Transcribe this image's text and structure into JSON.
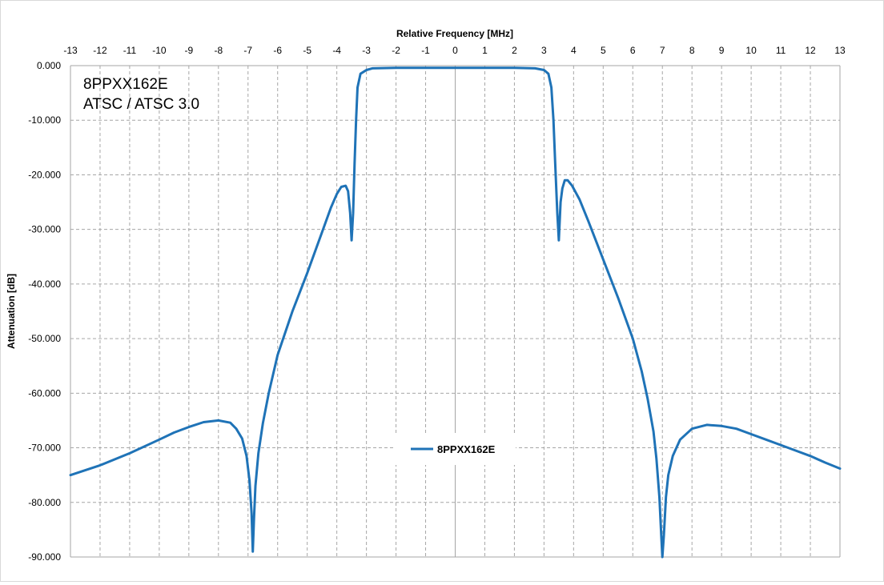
{
  "chart_data": {
    "type": "line",
    "title": "",
    "xlabel": "Relative Frequency [MHz]",
    "ylabel": "Attenuation [dB]",
    "xlim": [
      -13,
      13
    ],
    "ylim": [
      -90,
      0
    ],
    "xticks": [
      "-13",
      "-12",
      "-11",
      "-10",
      "-9",
      "-8",
      "-7",
      "-6",
      "-5",
      "-4",
      "-3",
      "-2",
      "-1",
      "0",
      "1",
      "2",
      "3",
      "4",
      "5",
      "6",
      "7",
      "8",
      "9",
      "10",
      "11",
      "12",
      "13"
    ],
    "yticks": [
      "0.000",
      "-10.000",
      "-20.000",
      "-30.000",
      "-40.000",
      "-50.000",
      "-60.000",
      "-70.000",
      "-80.000",
      "-90.000"
    ],
    "x_axis_position": "top",
    "grid": "dashed",
    "legend_position": "center",
    "annotations": [
      "8PPXX162E",
      "ATSC / ATSC 3.0"
    ],
    "series": [
      {
        "name": "8PPXX162E",
        "color": "#1f73b7",
        "points": [
          [
            -13.0,
            -75.0
          ],
          [
            -12.0,
            -73.2
          ],
          [
            -11.0,
            -71.0
          ],
          [
            -10.0,
            -68.5
          ],
          [
            -9.5,
            -67.2
          ],
          [
            -9.0,
            -66.2
          ],
          [
            -8.5,
            -65.3
          ],
          [
            -8.0,
            -65.0
          ],
          [
            -7.6,
            -65.4
          ],
          [
            -7.4,
            -66.5
          ],
          [
            -7.2,
            -68.3
          ],
          [
            -7.05,
            -71.5
          ],
          [
            -6.95,
            -76.0
          ],
          [
            -6.88,
            -82.0
          ],
          [
            -6.84,
            -89.0
          ],
          [
            -6.8,
            -83.0
          ],
          [
            -6.75,
            -77.0
          ],
          [
            -6.65,
            -71.0
          ],
          [
            -6.5,
            -65.5
          ],
          [
            -6.3,
            -60.0
          ],
          [
            -6.0,
            -53.0
          ],
          [
            -5.5,
            -45.0
          ],
          [
            -5.0,
            -38.0
          ],
          [
            -4.5,
            -30.5
          ],
          [
            -4.2,
            -26.0
          ],
          [
            -4.0,
            -23.5
          ],
          [
            -3.85,
            -22.2
          ],
          [
            -3.7,
            -22.0
          ],
          [
            -3.62,
            -23.0
          ],
          [
            -3.55,
            -27.0
          ],
          [
            -3.5,
            -32.0
          ],
          [
            -3.45,
            -27.0
          ],
          [
            -3.4,
            -18.0
          ],
          [
            -3.35,
            -10.0
          ],
          [
            -3.3,
            -4.0
          ],
          [
            -3.2,
            -1.5
          ],
          [
            -3.0,
            -0.8
          ],
          [
            -2.8,
            -0.5
          ],
          [
            -2.0,
            -0.4
          ],
          [
            0.0,
            -0.4
          ],
          [
            2.0,
            -0.4
          ],
          [
            2.7,
            -0.5
          ],
          [
            3.0,
            -0.8
          ],
          [
            3.15,
            -1.5
          ],
          [
            3.25,
            -4.0
          ],
          [
            3.32,
            -10.0
          ],
          [
            3.38,
            -18.0
          ],
          [
            3.45,
            -27.0
          ],
          [
            3.5,
            -32.0
          ],
          [
            3.56,
            -25.0
          ],
          [
            3.62,
            -22.5
          ],
          [
            3.7,
            -21.0
          ],
          [
            3.8,
            -21.0
          ],
          [
            3.95,
            -22.0
          ],
          [
            4.2,
            -24.5
          ],
          [
            4.5,
            -28.5
          ],
          [
            5.0,
            -35.5
          ],
          [
            5.5,
            -42.5
          ],
          [
            6.0,
            -50.0
          ],
          [
            6.3,
            -56.0
          ],
          [
            6.5,
            -61.0
          ],
          [
            6.7,
            -67.0
          ],
          [
            6.8,
            -72.0
          ],
          [
            6.9,
            -79.0
          ],
          [
            6.96,
            -86.0
          ],
          [
            7.0,
            -90.0
          ],
          [
            7.05,
            -86.0
          ],
          [
            7.12,
            -79.0
          ],
          [
            7.2,
            -75.0
          ],
          [
            7.35,
            -71.5
          ],
          [
            7.6,
            -68.5
          ],
          [
            8.0,
            -66.5
          ],
          [
            8.5,
            -65.8
          ],
          [
            9.0,
            -66.0
          ],
          [
            9.5,
            -66.5
          ],
          [
            10.0,
            -67.5
          ],
          [
            10.5,
            -68.5
          ],
          [
            11.0,
            -69.5
          ],
          [
            11.5,
            -70.5
          ],
          [
            12.0,
            -71.5
          ],
          [
            12.5,
            -72.7
          ],
          [
            13.0,
            -73.8
          ]
        ]
      }
    ]
  }
}
